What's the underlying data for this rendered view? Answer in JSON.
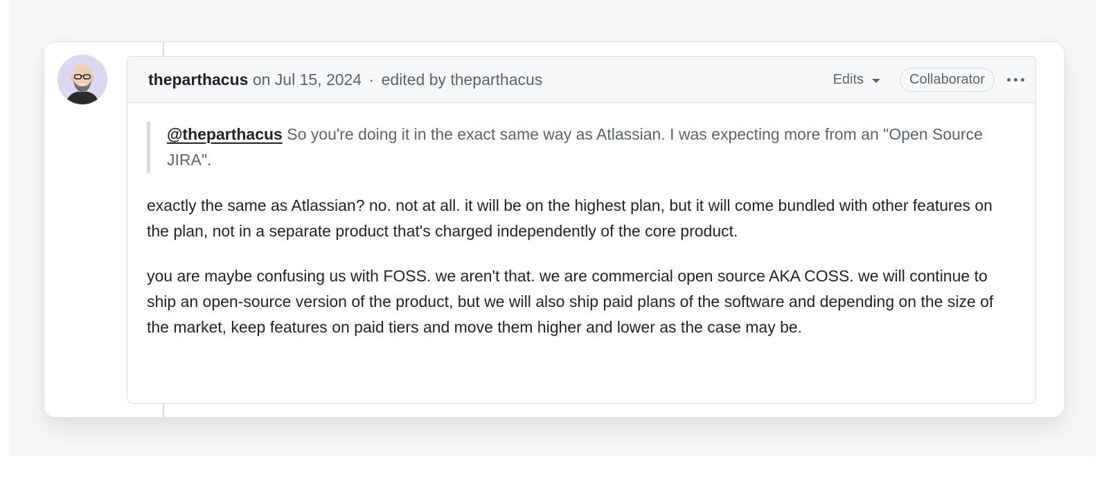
{
  "comment": {
    "author": "theparthacus",
    "date_prefix": "on Jul 15, 2024",
    "separator": "·",
    "edited_by": "edited by theparthacus",
    "edits_label": "Edits",
    "role_badge": "Collaborator",
    "menu_icon": "kebab-horizontal-icon",
    "quote": {
      "mention": "@theparthacus",
      "text": " So you're doing it in the exact same way as Atlassian. I was expecting more from an \"Open Source JIRA\"."
    },
    "paragraphs": [
      "exactly the same as Atlassian? no. not at all. it will be on the highest plan, but it will come bundled with other features on the plan, not in a separate product that's charged independently of the core product.",
      "you are maybe confusing us with FOSS. we aren't that. we are commercial open source AKA COSS. we will continue to ship an open-source version of the product, but we will also ship paid plans of the software and depending on the size of the market, keep features on paid tiers and move them higher and lower as the case may be."
    ]
  },
  "colors": {
    "background": "#f6f7f8",
    "header_bg": "#f6f8fa",
    "border": "#d5dbe1",
    "text_primary": "#1f2328",
    "text_muted": "#59636e",
    "avatar_bg": "#dcd7f3"
  }
}
